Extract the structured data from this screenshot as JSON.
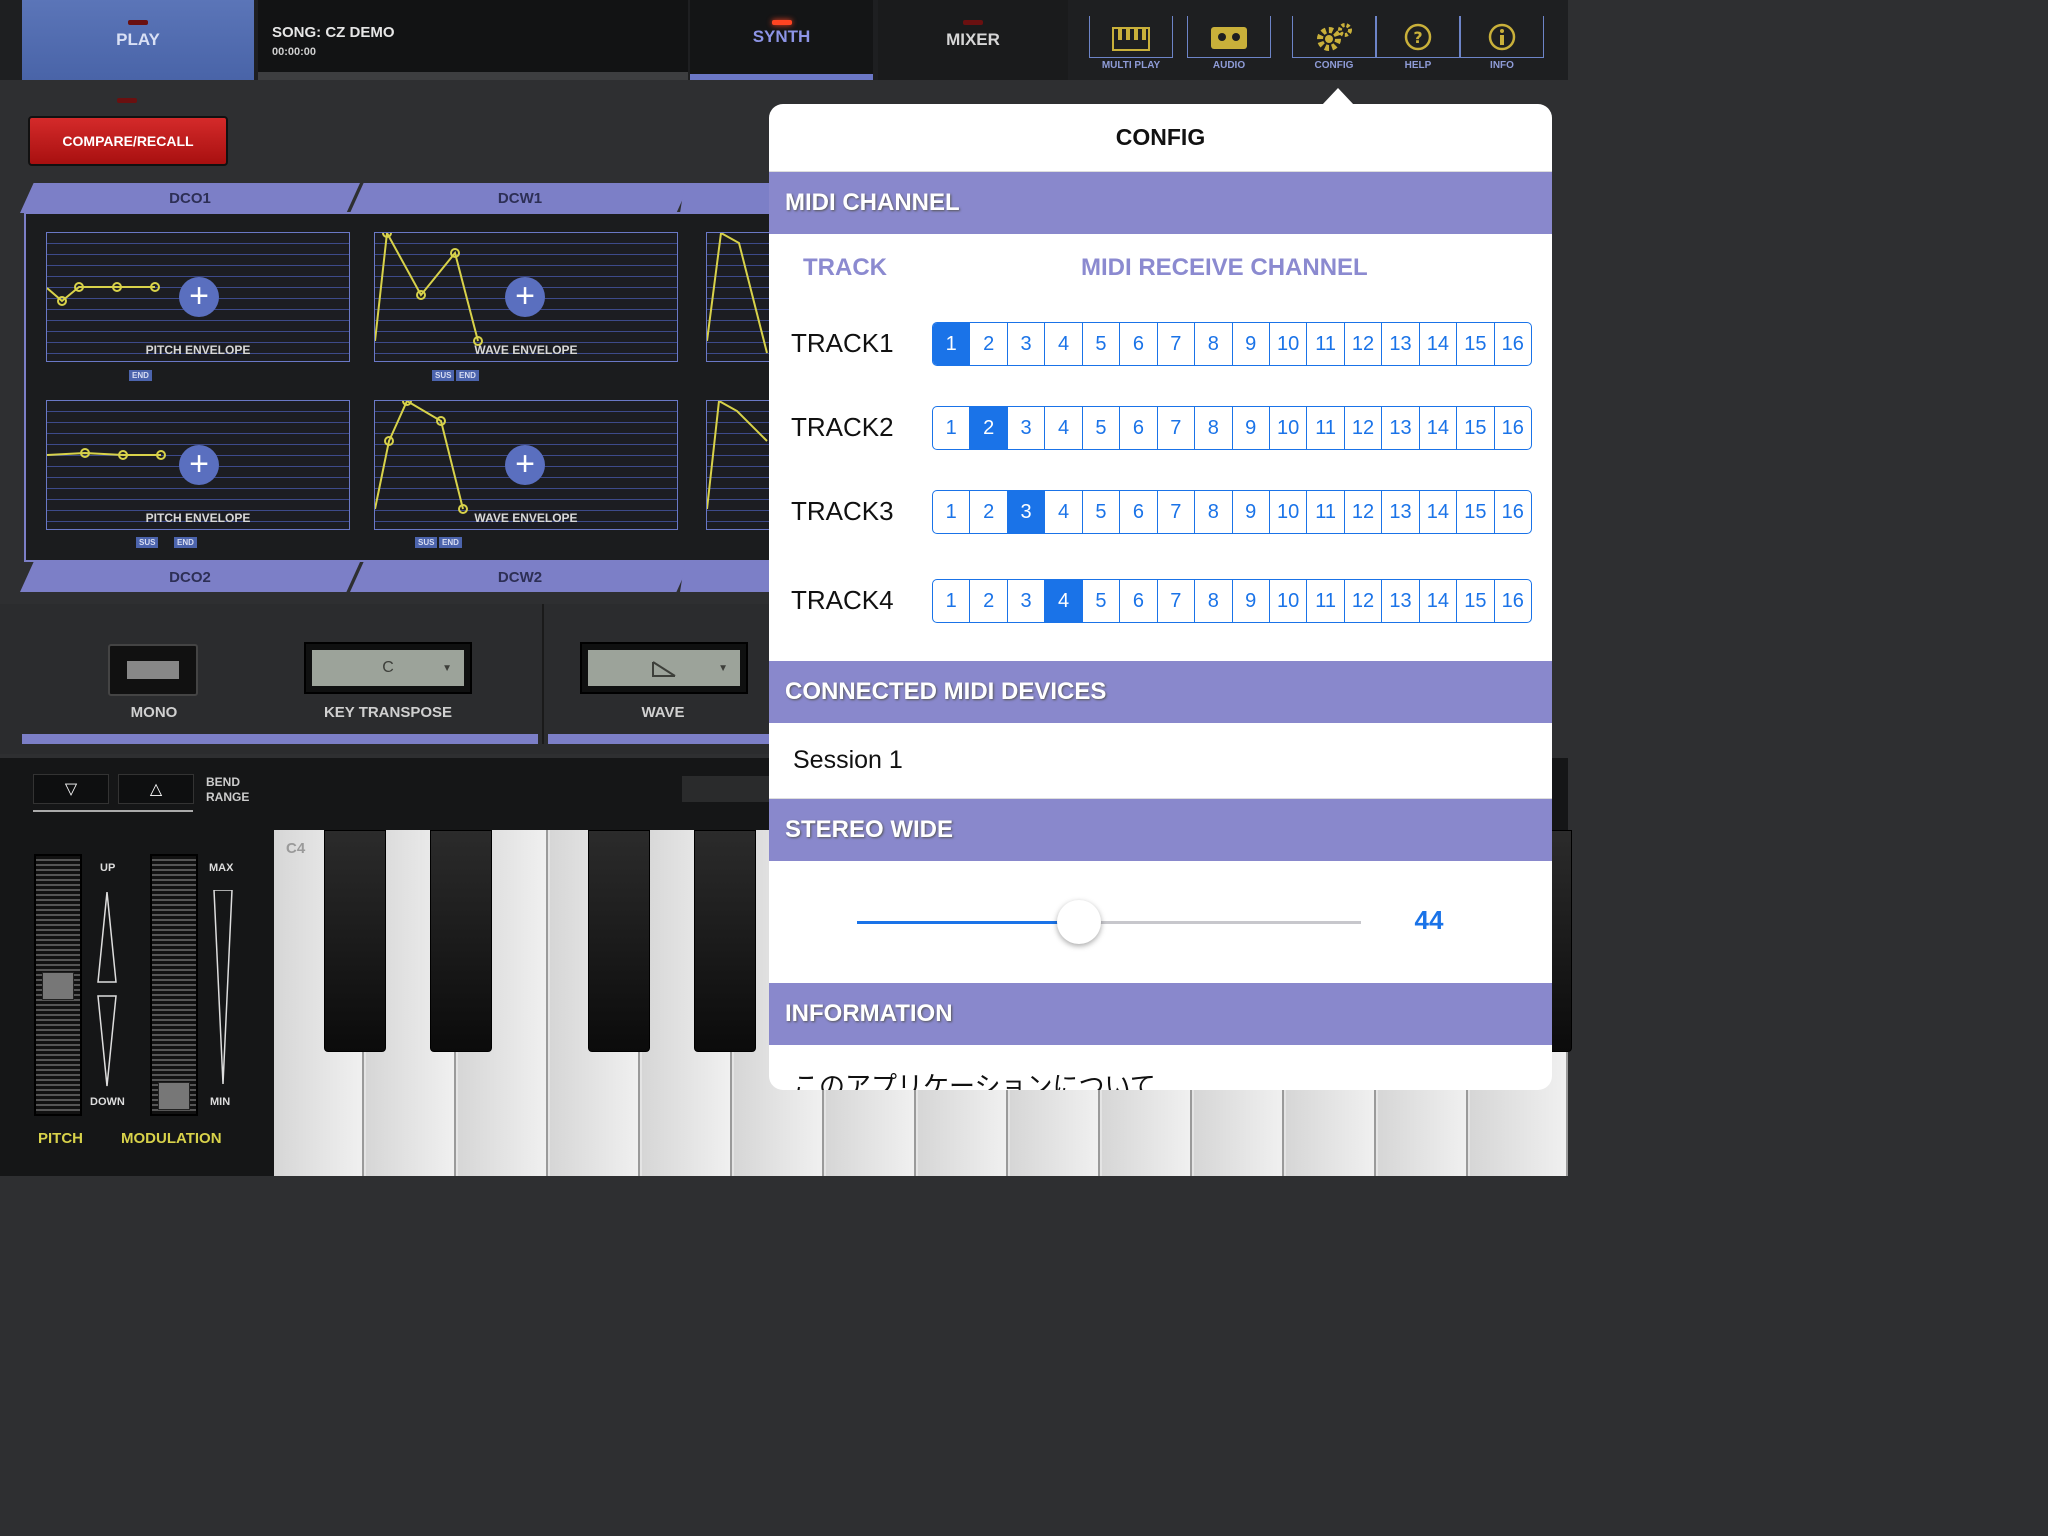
{
  "topbar": {
    "play_label": "PLAY",
    "song_title": "SONG: CZ DEMO",
    "song_time": "00:00:00",
    "synth_label": "SYNTH",
    "mixer_label": "MIXER",
    "icons": [
      {
        "icon": "keyboard-icon",
        "label": "MULTI PLAY"
      },
      {
        "icon": "cassette-icon",
        "label": "AUDIO"
      },
      {
        "icon": "gears-icon",
        "label": "CONFIG"
      },
      {
        "icon": "help-icon",
        "label": "HELP"
      },
      {
        "icon": "info-icon",
        "label": "INFO"
      }
    ],
    "accent_color": "#8d94e6"
  },
  "compare_label": "COMPARE/RECALL",
  "envelopes": {
    "dco1": "DCO1",
    "dcw1": "DCW1",
    "dco2": "DCO2",
    "dcw2": "DCW2",
    "pitch_envelope": "PITCH ENVELOPE",
    "wave_envelope": "WAVE ENVELOPE",
    "tag_sus": "SUS",
    "tag_end": "END"
  },
  "controls": {
    "mono": "MONO",
    "key_transpose": "KEY TRANSPOSE",
    "key_value": "C",
    "wave": "WAVE"
  },
  "bend": {
    "down_symbol": "▽",
    "up_symbol": "△",
    "label_line1": "BEND",
    "label_line2": "RANGE"
  },
  "wheels": {
    "up": "UP",
    "down": "DOWN",
    "max": "MAX",
    "min": "MIN",
    "pitch": "PITCH",
    "modulation": "MODULATION"
  },
  "keyboard": {
    "start_note": "C4"
  },
  "config": {
    "title": "CONFIG",
    "midi_channel_header": "MIDI CHANNEL",
    "track_col": "TRACK",
    "receive_col": "MIDI RECEIVE CHANNEL",
    "channels": [
      "1",
      "2",
      "3",
      "4",
      "5",
      "6",
      "7",
      "8",
      "9",
      "10",
      "11",
      "12",
      "13",
      "14",
      "15",
      "16"
    ],
    "tracks": [
      {
        "name": "TRACK1",
        "selected": 1
      },
      {
        "name": "TRACK2",
        "selected": 2
      },
      {
        "name": "TRACK3",
        "selected": 3
      },
      {
        "name": "TRACK4",
        "selected": 4
      }
    ],
    "connected_header": "CONNECTED MIDI DEVICES",
    "device": "Session 1",
    "stereo_header": "STEREO WIDE",
    "stereo_value": 44,
    "stereo_value_text": "44",
    "information_header": "INFORMATION",
    "about": "このアプリケーションについて",
    "selected_color": "#1a73e8",
    "section_color": "#8988cc"
  }
}
